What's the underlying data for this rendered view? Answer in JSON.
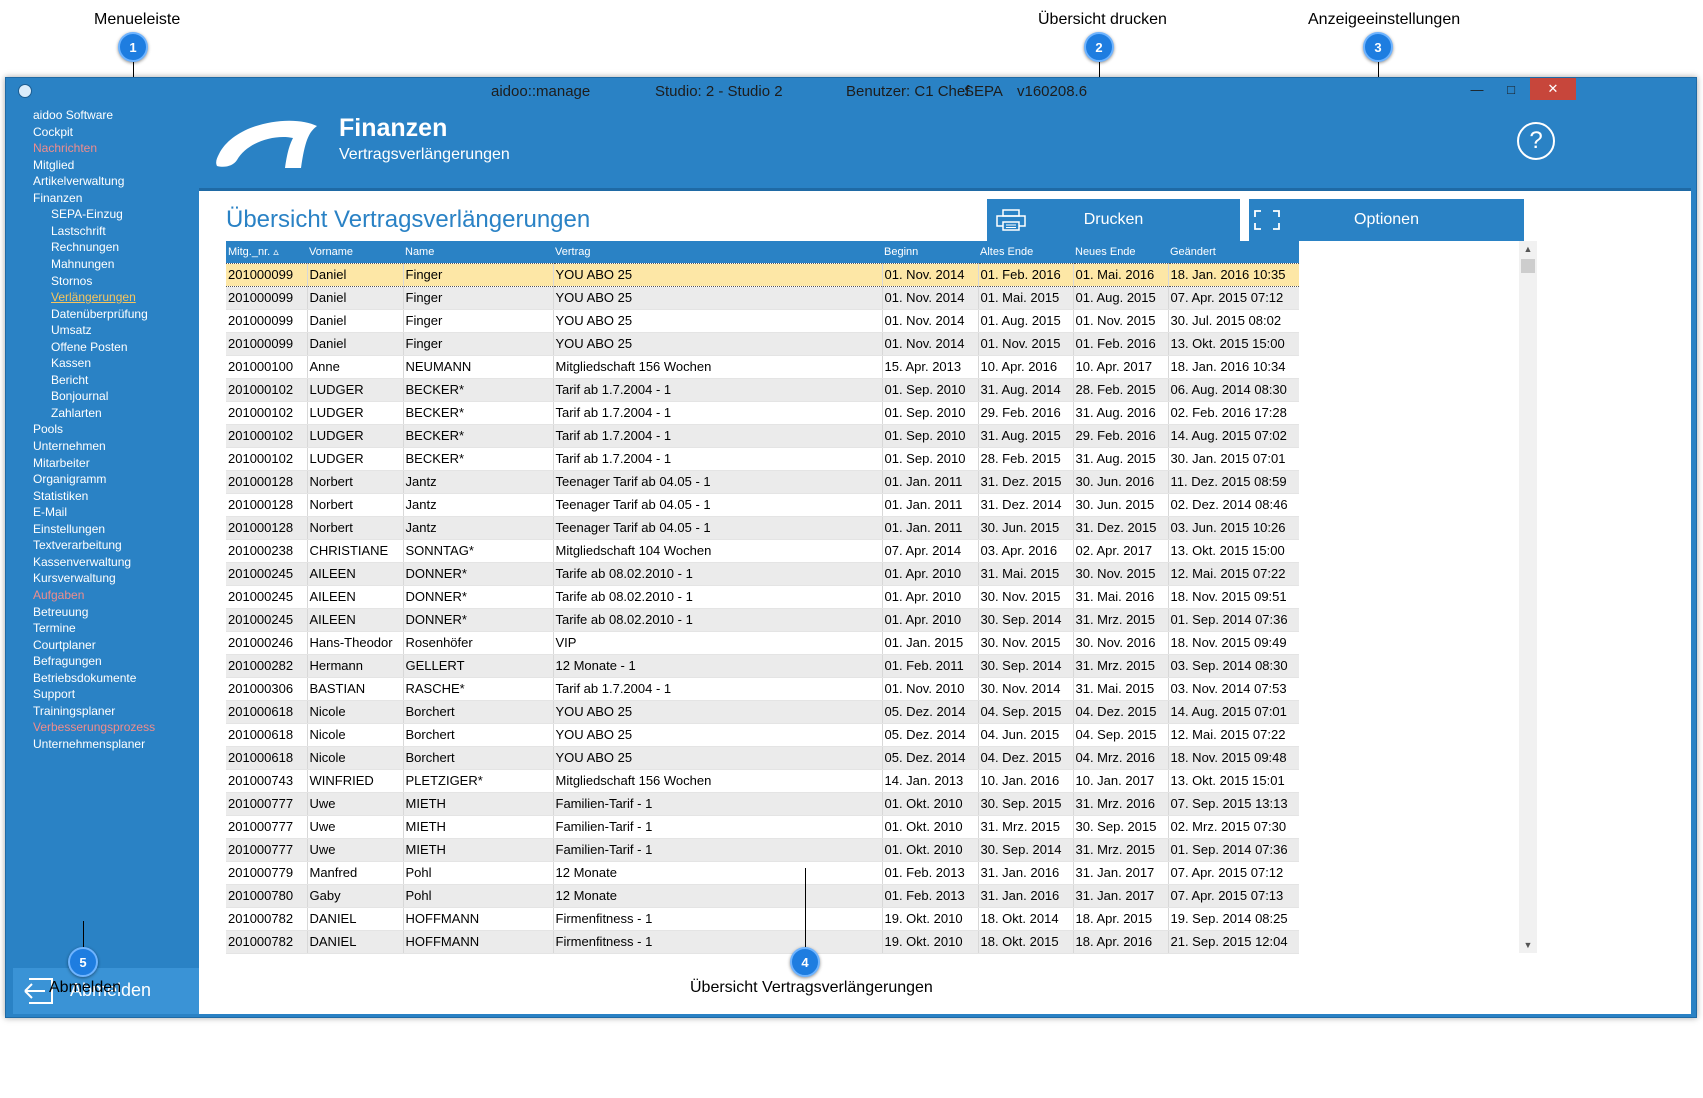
{
  "callouts": [
    {
      "num": "1",
      "label": "Menueleiste"
    },
    {
      "num": "2",
      "label": "Übersicht drucken"
    },
    {
      "num": "3",
      "label": "Anzeigeeinstellungen"
    },
    {
      "num": "4",
      "label": "Übersicht Vertragsverlängerungen"
    },
    {
      "num": "5",
      "label": "Abmelden"
    }
  ],
  "titlebar": {
    "app": "aidoo::manage",
    "studio": "Studio: 2 - Studio 2",
    "user": "Benutzer: C1 Chef",
    "sepa": "SEPA",
    "version": "v160208.6",
    "minimize": "—",
    "maximize": "□",
    "close": "✕"
  },
  "sidebar": {
    "items": [
      {
        "label": "aidoo Software",
        "style": "normal",
        "indent": 0
      },
      {
        "label": "Cockpit",
        "style": "normal",
        "indent": 0
      },
      {
        "label": "Nachrichten",
        "style": "red",
        "indent": 0
      },
      {
        "label": "Mitglied",
        "style": "normal",
        "indent": 0
      },
      {
        "label": "Artikelverwaltung",
        "style": "normal",
        "indent": 0
      },
      {
        "label": "Finanzen",
        "style": "normal",
        "indent": 0
      },
      {
        "label": "SEPA-Einzug",
        "style": "normal",
        "indent": 1
      },
      {
        "label": "Lastschrift",
        "style": "normal",
        "indent": 1
      },
      {
        "label": "Rechnungen",
        "style": "normal",
        "indent": 1
      },
      {
        "label": "Mahnungen",
        "style": "normal",
        "indent": 1
      },
      {
        "label": "Stornos",
        "style": "normal",
        "indent": 1
      },
      {
        "label": "Verlängerungen",
        "style": "active",
        "indent": 1
      },
      {
        "label": "Datenüberprüfung",
        "style": "normal",
        "indent": 1
      },
      {
        "label": "Umsatz",
        "style": "normal",
        "indent": 1
      },
      {
        "label": "Offene Posten",
        "style": "normal",
        "indent": 1
      },
      {
        "label": "Kassen",
        "style": "normal",
        "indent": 1
      },
      {
        "label": "Bericht",
        "style": "normal",
        "indent": 1
      },
      {
        "label": "Bonjournal",
        "style": "normal",
        "indent": 1
      },
      {
        "label": "Zahlarten",
        "style": "normal",
        "indent": 1
      },
      {
        "label": "Pools",
        "style": "normal",
        "indent": 0
      },
      {
        "label": "Unternehmen",
        "style": "normal",
        "indent": 0
      },
      {
        "label": "Mitarbeiter",
        "style": "normal",
        "indent": 0
      },
      {
        "label": "Organigramm",
        "style": "normal",
        "indent": 0
      },
      {
        "label": "Statistiken",
        "style": "normal",
        "indent": 0
      },
      {
        "label": "E-Mail",
        "style": "normal",
        "indent": 0
      },
      {
        "label": "Einstellungen",
        "style": "normal",
        "indent": 0
      },
      {
        "label": "Textverarbeitung",
        "style": "normal",
        "indent": 0
      },
      {
        "label": "Kassenverwaltung",
        "style": "normal",
        "indent": 0
      },
      {
        "label": "Kursverwaltung",
        "style": "normal",
        "indent": 0
      },
      {
        "label": "Aufgaben",
        "style": "red",
        "indent": 0
      },
      {
        "label": "Betreuung",
        "style": "normal",
        "indent": 0
      },
      {
        "label": "Termine",
        "style": "normal",
        "indent": 0
      },
      {
        "label": "Courtplaner",
        "style": "normal",
        "indent": 0
      },
      {
        "label": "Befragungen",
        "style": "normal",
        "indent": 0
      },
      {
        "label": "Betriebsdokumente",
        "style": "normal",
        "indent": 0
      },
      {
        "label": "Support",
        "style": "normal",
        "indent": 0
      },
      {
        "label": "Trainingsplaner",
        "style": "normal",
        "indent": 0
      },
      {
        "label": "Verbesserungsprozess",
        "style": "red",
        "indent": 0
      },
      {
        "label": "Unternehmensplaner",
        "style": "normal",
        "indent": 0
      }
    ],
    "logout_label": "Abmelden"
  },
  "header": {
    "title": "Finanzen",
    "subtitle": "Vertragsverlängerungen",
    "help": "?"
  },
  "page_heading": "Übersicht Vertragsverlängerungen",
  "buttons": {
    "print": "Drucken",
    "options": "Optionen"
  },
  "table": {
    "columns": [
      "Mitg._nr. ▵",
      "Vorname",
      "Name",
      "Vertrag",
      "Beginn",
      "Altes Ende",
      "Neues Ende",
      "Geändert"
    ],
    "selected_row": 0,
    "rows": [
      [
        "201000099",
        "Daniel",
        "Finger",
        "YOU ABO 25",
        "01. Nov. 2014",
        "01. Feb. 2016",
        "01. Mai. 2016",
        "18. Jan. 2016 10:35"
      ],
      [
        "201000099",
        "Daniel",
        "Finger",
        "YOU ABO 25",
        "01. Nov. 2014",
        "01. Mai. 2015",
        "01. Aug. 2015",
        "07. Apr. 2015 07:12"
      ],
      [
        "201000099",
        "Daniel",
        "Finger",
        "YOU ABO 25",
        "01. Nov. 2014",
        "01. Aug. 2015",
        "01. Nov. 2015",
        "30. Jul. 2015 08:02"
      ],
      [
        "201000099",
        "Daniel",
        "Finger",
        "YOU ABO 25",
        "01. Nov. 2014",
        "01. Nov. 2015",
        "01. Feb. 2016",
        "13. Okt. 2015 15:00"
      ],
      [
        "201000100",
        "Anne",
        "NEUMANN",
        "Mitgliedschaft 156 Wochen",
        "15. Apr. 2013",
        "10. Apr. 2016",
        "10. Apr. 2017",
        "18. Jan. 2016 10:34"
      ],
      [
        "201000102",
        "LUDGER",
        "BECKER*",
        "Tarif ab 1.7.2004 - 1",
        "01. Sep. 2010",
        "31. Aug. 2014",
        "28. Feb. 2015",
        "06. Aug. 2014 08:30"
      ],
      [
        "201000102",
        "LUDGER",
        "BECKER*",
        "Tarif ab 1.7.2004 - 1",
        "01. Sep. 2010",
        "29. Feb. 2016",
        "31. Aug. 2016",
        "02. Feb. 2016 17:28"
      ],
      [
        "201000102",
        "LUDGER",
        "BECKER*",
        "Tarif ab 1.7.2004 - 1",
        "01. Sep. 2010",
        "31. Aug. 2015",
        "29. Feb. 2016",
        "14. Aug. 2015 07:02"
      ],
      [
        "201000102",
        "LUDGER",
        "BECKER*",
        "Tarif ab 1.7.2004 - 1",
        "01. Sep. 2010",
        "28. Feb. 2015",
        "31. Aug. 2015",
        "30. Jan. 2015 07:01"
      ],
      [
        "201000128",
        "Norbert",
        "Jantz",
        "Teenager Tarif ab 04.05 - 1",
        "01. Jan. 2011",
        "31. Dez. 2015",
        "30. Jun. 2016",
        "11. Dez. 2015 08:59"
      ],
      [
        "201000128",
        "Norbert",
        "Jantz",
        "Teenager Tarif ab 04.05 - 1",
        "01. Jan. 2011",
        "31. Dez. 2014",
        "30. Jun. 2015",
        "02. Dez. 2014 08:46"
      ],
      [
        "201000128",
        "Norbert",
        "Jantz",
        "Teenager Tarif ab 04.05 - 1",
        "01. Jan. 2011",
        "30. Jun. 2015",
        "31. Dez. 2015",
        "03. Jun. 2015 10:26"
      ],
      [
        "201000238",
        "CHRISTIANE",
        "SONNTAG*",
        "Mitgliedschaft 104 Wochen",
        "07. Apr. 2014",
        "03. Apr. 2016",
        "02. Apr. 2017",
        "13. Okt. 2015 15:00"
      ],
      [
        "201000245",
        "AILEEN",
        "DONNER*",
        "Tarife ab 08.02.2010 - 1",
        "01. Apr. 2010",
        "31. Mai. 2015",
        "30. Nov. 2015",
        "12. Mai. 2015 07:22"
      ],
      [
        "201000245",
        "AILEEN",
        "DONNER*",
        "Tarife ab 08.02.2010 - 1",
        "01. Apr. 2010",
        "30. Nov. 2015",
        "31. Mai. 2016",
        "18. Nov. 2015 09:51"
      ],
      [
        "201000245",
        "AILEEN",
        "DONNER*",
        "Tarife ab 08.02.2010 - 1",
        "01. Apr. 2010",
        "30. Sep. 2014",
        "31. Mrz. 2015",
        "01. Sep. 2014 07:36"
      ],
      [
        "201000246",
        "Hans-Theodor",
        "Rosenhöfer",
        "VIP",
        "01. Jan. 2015",
        "30. Nov. 2015",
        "30. Nov. 2016",
        "18. Nov. 2015 09:49"
      ],
      [
        "201000282",
        "Hermann",
        "GELLERT",
        "12 Monate - 1",
        "01. Feb. 2011",
        "30. Sep. 2014",
        "31. Mrz. 2015",
        "03. Sep. 2014 08:30"
      ],
      [
        "201000306",
        "BASTIAN",
        "RASCHE*",
        "Tarif ab 1.7.2004 - 1",
        "01. Nov. 2010",
        "30. Nov. 2014",
        "31. Mai. 2015",
        "03. Nov. 2014 07:53"
      ],
      [
        "201000618",
        "Nicole",
        "Borchert",
        "YOU ABO 25",
        "05. Dez. 2014",
        "04. Sep. 2015",
        "04. Dez. 2015",
        "14. Aug. 2015 07:01"
      ],
      [
        "201000618",
        "Nicole",
        "Borchert",
        "YOU ABO 25",
        "05. Dez. 2014",
        "04. Jun. 2015",
        "04. Sep. 2015",
        "12. Mai. 2015 07:22"
      ],
      [
        "201000618",
        "Nicole",
        "Borchert",
        "YOU ABO 25",
        "05. Dez. 2014",
        "04. Dez. 2015",
        "04. Mrz. 2016",
        "18. Nov. 2015 09:48"
      ],
      [
        "201000743",
        "WINFRIED",
        "PLETZIGER*",
        "Mitgliedschaft 156 Wochen",
        "14. Jan. 2013",
        "10. Jan. 2016",
        "10. Jan. 2017",
        "13. Okt. 2015 15:01"
      ],
      [
        "201000777",
        "Uwe",
        "MIETH",
        "Familien-Tarif - 1",
        "01. Okt. 2010",
        "30. Sep. 2015",
        "31. Mrz. 2016",
        "07. Sep. 2015 13:13"
      ],
      [
        "201000777",
        "Uwe",
        "MIETH",
        "Familien-Tarif - 1",
        "01. Okt. 2010",
        "31. Mrz. 2015",
        "30. Sep. 2015",
        "02. Mrz. 2015 07:30"
      ],
      [
        "201000777",
        "Uwe",
        "MIETH",
        "Familien-Tarif - 1",
        "01. Okt. 2010",
        "30. Sep. 2014",
        "31. Mrz. 2015",
        "01. Sep. 2014 07:36"
      ],
      [
        "201000779",
        "Manfred",
        "Pohl",
        "12 Monate",
        "01. Feb. 2013",
        "31. Jan. 2016",
        "31. Jan. 2017",
        "07. Apr. 2015 07:12"
      ],
      [
        "201000780",
        "Gaby",
        "Pohl",
        "12 Monate",
        "01. Feb. 2013",
        "31. Jan. 2016",
        "31. Jan. 2017",
        "07. Apr. 2015 07:13"
      ],
      [
        "201000782",
        "DANIEL",
        "HOFFMANN",
        "Firmenfitness - 1",
        "19. Okt. 2010",
        "18. Okt. 2014",
        "18. Apr. 2015",
        "19. Sep. 2014 08:25"
      ],
      [
        "201000782",
        "DANIEL",
        "HOFFMANN",
        "Firmenfitness - 1",
        "19. Okt. 2010",
        "18. Okt. 2015",
        "18. Apr. 2016",
        "21. Sep. 2015 12:04"
      ]
    ]
  },
  "scrollbar": {
    "up": "▲",
    "down": "▼"
  },
  "icons": {
    "print": "printer-icon",
    "options": "fullscreen-icon",
    "logout": "arrow-left-icon",
    "help": "question-icon",
    "logo": "aidoo-logo"
  }
}
